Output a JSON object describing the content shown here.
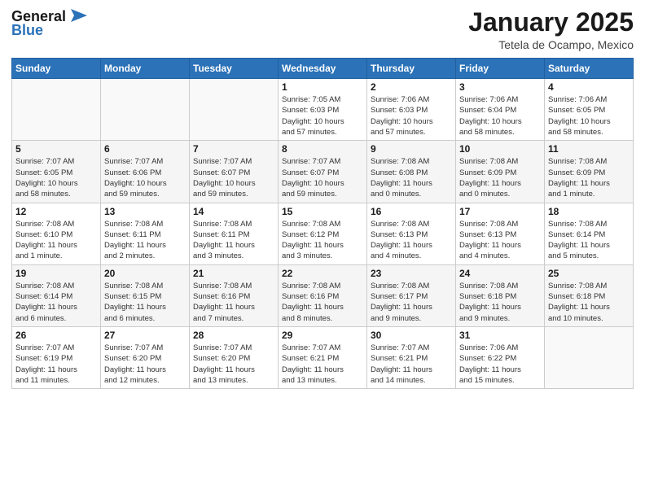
{
  "header": {
    "logo_general": "General",
    "logo_blue": "Blue",
    "title": "January 2025",
    "subtitle": "Tetela de Ocampo, Mexico"
  },
  "days_of_week": [
    "Sunday",
    "Monday",
    "Tuesday",
    "Wednesday",
    "Thursday",
    "Friday",
    "Saturday"
  ],
  "weeks": [
    [
      {
        "day": "",
        "info": ""
      },
      {
        "day": "",
        "info": ""
      },
      {
        "day": "",
        "info": ""
      },
      {
        "day": "1",
        "info": "Sunrise: 7:05 AM\nSunset: 6:03 PM\nDaylight: 10 hours\nand 57 minutes."
      },
      {
        "day": "2",
        "info": "Sunrise: 7:06 AM\nSunset: 6:03 PM\nDaylight: 10 hours\nand 57 minutes."
      },
      {
        "day": "3",
        "info": "Sunrise: 7:06 AM\nSunset: 6:04 PM\nDaylight: 10 hours\nand 58 minutes."
      },
      {
        "day": "4",
        "info": "Sunrise: 7:06 AM\nSunset: 6:05 PM\nDaylight: 10 hours\nand 58 minutes."
      }
    ],
    [
      {
        "day": "5",
        "info": "Sunrise: 7:07 AM\nSunset: 6:05 PM\nDaylight: 10 hours\nand 58 minutes."
      },
      {
        "day": "6",
        "info": "Sunrise: 7:07 AM\nSunset: 6:06 PM\nDaylight: 10 hours\nand 59 minutes."
      },
      {
        "day": "7",
        "info": "Sunrise: 7:07 AM\nSunset: 6:07 PM\nDaylight: 10 hours\nand 59 minutes."
      },
      {
        "day": "8",
        "info": "Sunrise: 7:07 AM\nSunset: 6:07 PM\nDaylight: 10 hours\nand 59 minutes."
      },
      {
        "day": "9",
        "info": "Sunrise: 7:08 AM\nSunset: 6:08 PM\nDaylight: 11 hours\nand 0 minutes."
      },
      {
        "day": "10",
        "info": "Sunrise: 7:08 AM\nSunset: 6:09 PM\nDaylight: 11 hours\nand 0 minutes."
      },
      {
        "day": "11",
        "info": "Sunrise: 7:08 AM\nSunset: 6:09 PM\nDaylight: 11 hours\nand 1 minute."
      }
    ],
    [
      {
        "day": "12",
        "info": "Sunrise: 7:08 AM\nSunset: 6:10 PM\nDaylight: 11 hours\nand 1 minute."
      },
      {
        "day": "13",
        "info": "Sunrise: 7:08 AM\nSunset: 6:11 PM\nDaylight: 11 hours\nand 2 minutes."
      },
      {
        "day": "14",
        "info": "Sunrise: 7:08 AM\nSunset: 6:11 PM\nDaylight: 11 hours\nand 3 minutes."
      },
      {
        "day": "15",
        "info": "Sunrise: 7:08 AM\nSunset: 6:12 PM\nDaylight: 11 hours\nand 3 minutes."
      },
      {
        "day": "16",
        "info": "Sunrise: 7:08 AM\nSunset: 6:13 PM\nDaylight: 11 hours\nand 4 minutes."
      },
      {
        "day": "17",
        "info": "Sunrise: 7:08 AM\nSunset: 6:13 PM\nDaylight: 11 hours\nand 4 minutes."
      },
      {
        "day": "18",
        "info": "Sunrise: 7:08 AM\nSunset: 6:14 PM\nDaylight: 11 hours\nand 5 minutes."
      }
    ],
    [
      {
        "day": "19",
        "info": "Sunrise: 7:08 AM\nSunset: 6:14 PM\nDaylight: 11 hours\nand 6 minutes."
      },
      {
        "day": "20",
        "info": "Sunrise: 7:08 AM\nSunset: 6:15 PM\nDaylight: 11 hours\nand 6 minutes."
      },
      {
        "day": "21",
        "info": "Sunrise: 7:08 AM\nSunset: 6:16 PM\nDaylight: 11 hours\nand 7 minutes."
      },
      {
        "day": "22",
        "info": "Sunrise: 7:08 AM\nSunset: 6:16 PM\nDaylight: 11 hours\nand 8 minutes."
      },
      {
        "day": "23",
        "info": "Sunrise: 7:08 AM\nSunset: 6:17 PM\nDaylight: 11 hours\nand 9 minutes."
      },
      {
        "day": "24",
        "info": "Sunrise: 7:08 AM\nSunset: 6:18 PM\nDaylight: 11 hours\nand 9 minutes."
      },
      {
        "day": "25",
        "info": "Sunrise: 7:08 AM\nSunset: 6:18 PM\nDaylight: 11 hours\nand 10 minutes."
      }
    ],
    [
      {
        "day": "26",
        "info": "Sunrise: 7:07 AM\nSunset: 6:19 PM\nDaylight: 11 hours\nand 11 minutes."
      },
      {
        "day": "27",
        "info": "Sunrise: 7:07 AM\nSunset: 6:20 PM\nDaylight: 11 hours\nand 12 minutes."
      },
      {
        "day": "28",
        "info": "Sunrise: 7:07 AM\nSunset: 6:20 PM\nDaylight: 11 hours\nand 13 minutes."
      },
      {
        "day": "29",
        "info": "Sunrise: 7:07 AM\nSunset: 6:21 PM\nDaylight: 11 hours\nand 13 minutes."
      },
      {
        "day": "30",
        "info": "Sunrise: 7:07 AM\nSunset: 6:21 PM\nDaylight: 11 hours\nand 14 minutes."
      },
      {
        "day": "31",
        "info": "Sunrise: 7:06 AM\nSunset: 6:22 PM\nDaylight: 11 hours\nand 15 minutes."
      },
      {
        "day": "",
        "info": ""
      }
    ]
  ]
}
